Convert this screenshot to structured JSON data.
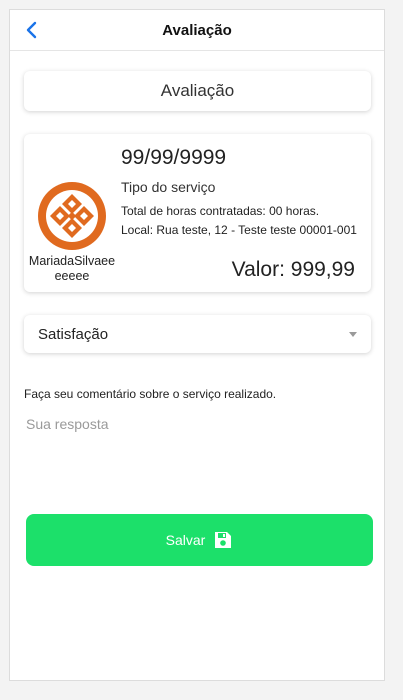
{
  "header": {
    "title": "Avaliação",
    "back_icon": "chevron-left-icon",
    "accent_color": "#1a73e8"
  },
  "title_card": {
    "text": "Avaliação"
  },
  "service_card": {
    "date": "99/99/9999",
    "service_type": "Tipo do serviço",
    "hours": "Total de horas contratadas: 00 horas.",
    "location": "Local: Rua teste, 12 - Teste teste 00001-001",
    "value": "Valor: 999,99",
    "provider_name": "MariadaSilvaeeeeeee",
    "logo_icon": "provider-logo-icon",
    "logo_color": "#e06a1f"
  },
  "satisfaction": {
    "selected": "Satisfação"
  },
  "comment": {
    "label": "Faça seu comentário sobre o serviço realizado.",
    "placeholder": "Sua resposta"
  },
  "save_button": {
    "label": "Salvar",
    "icon": "floppy-disk-icon",
    "color": "#1ce06a"
  }
}
